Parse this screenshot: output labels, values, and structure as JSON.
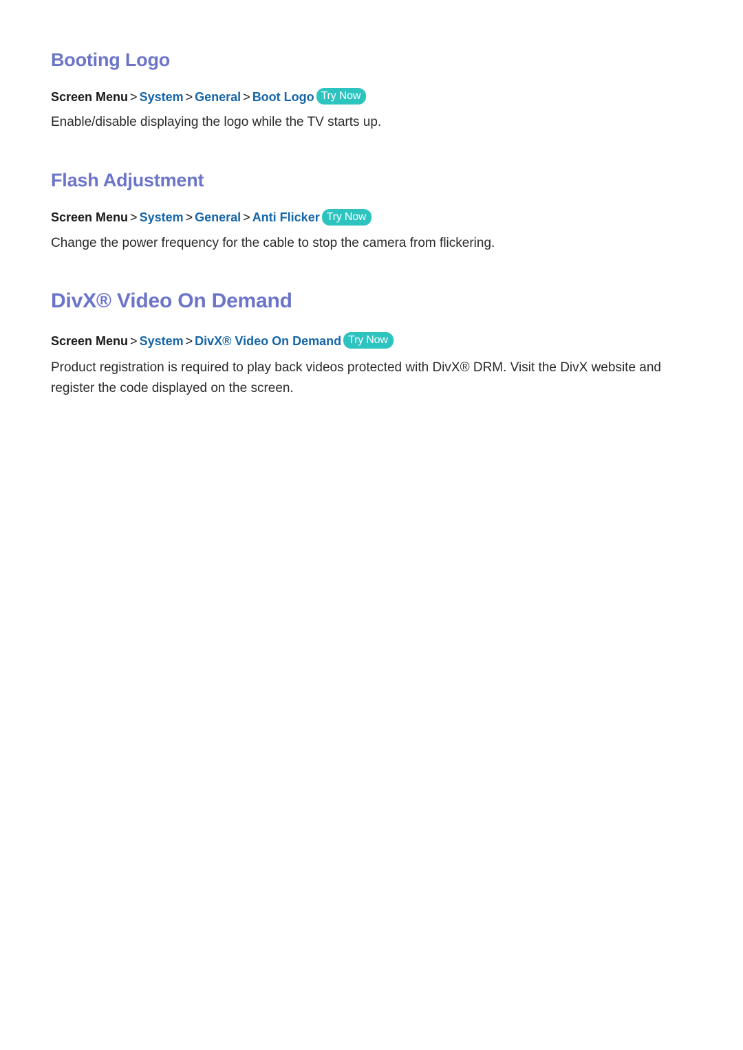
{
  "page": {
    "background_color": "#ffffff",
    "heading_color": "#6B74C8",
    "link_color": "#1565A8",
    "body_color": "#2A2A2A",
    "badge_color": "#2DC4C0",
    "badge_text_color": "#ffffff"
  },
  "sections": [
    {
      "heading": "Booting Logo",
      "breadcrumb": {
        "root": "Screen Menu",
        "separator": ">",
        "links": [
          "System",
          "General",
          "Boot Logo"
        ],
        "badge": "Try Now"
      },
      "body": "Enable/disable displaying the logo while the TV starts up."
    },
    {
      "heading": "Flash Adjustment",
      "breadcrumb": {
        "root": "Screen Menu",
        "separator": ">",
        "links": [
          "System",
          "General",
          "Anti Flicker"
        ],
        "badge": "Try Now"
      },
      "body": "Change the power frequency for the cable to stop the camera from flickering."
    },
    {
      "heading": "DivX® Video On Demand",
      "breadcrumb": {
        "root": "Screen Menu",
        "separator": ">",
        "links": [
          "System",
          "DivX® Video On Demand"
        ],
        "badge": "Try Now"
      },
      "body": "Product registration is required to play back videos protected with DivX® DRM. Visit the DivX website and register the code displayed on the screen."
    }
  ]
}
